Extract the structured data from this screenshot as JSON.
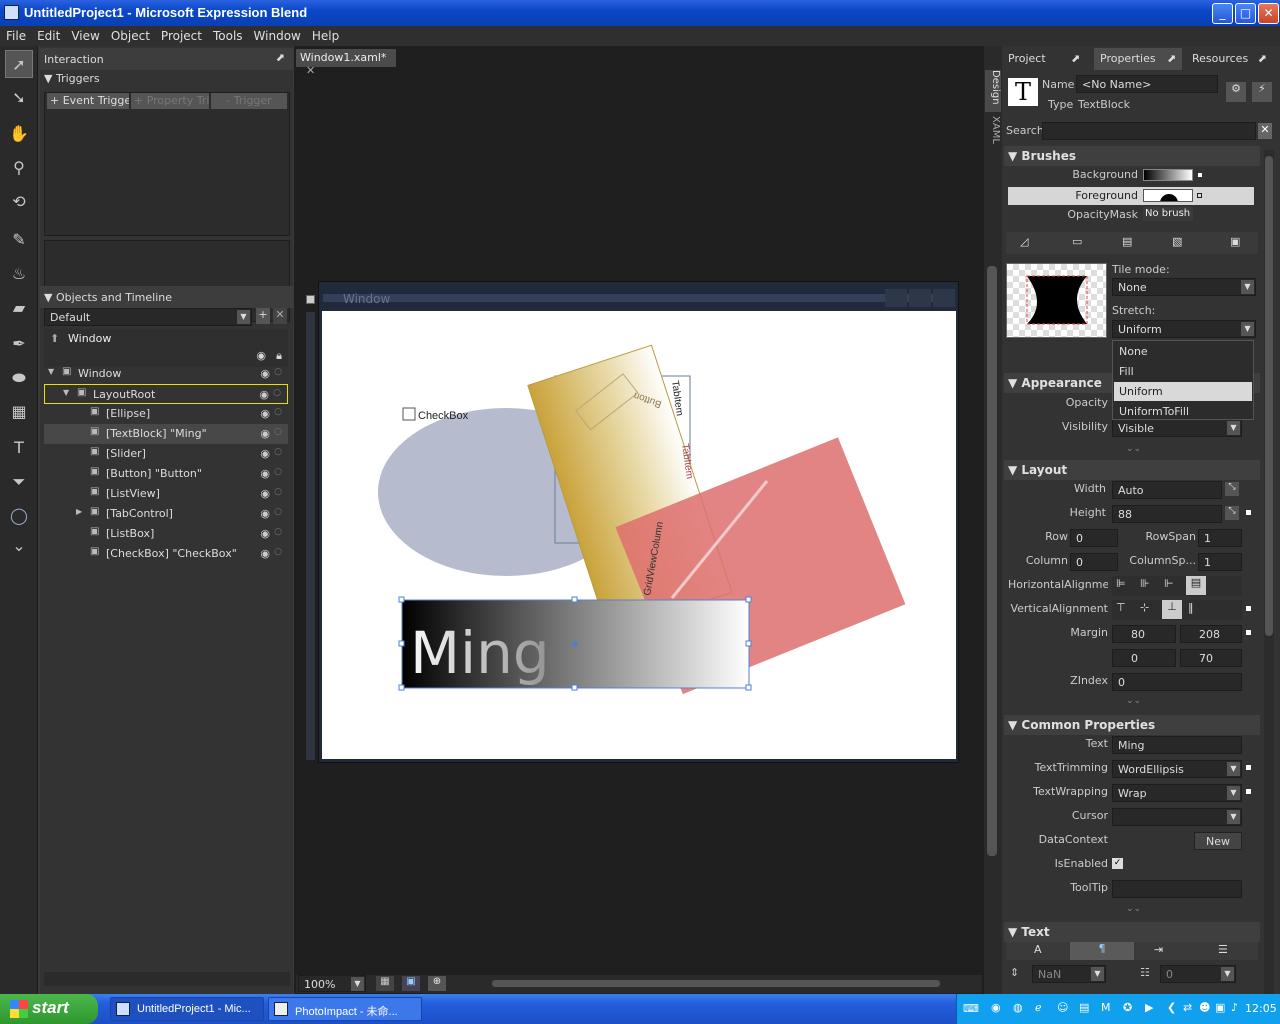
{
  "window": {
    "title": "UntitledProject1 - Microsoft Expression Blend",
    "min": "_",
    "max": "□",
    "close": "✕"
  },
  "menu": [
    "File",
    "Edit",
    "View",
    "Object",
    "Project",
    "Tools",
    "Window",
    "Help"
  ],
  "left": {
    "interaction_title": "Interaction",
    "triggers_title": "Triggers",
    "trigger_buttons": [
      "+ Event Trigger",
      "+ Property Trigg",
      "- Trigger"
    ],
    "objects_title": "Objects and Timeline",
    "timeline_default": "Default",
    "scope_label": "Window",
    "tree": [
      {
        "label": "Window",
        "indent": 0,
        "expander": "▼",
        "selected": false,
        "highlight": false
      },
      {
        "label": "LayoutRoot",
        "indent": 1,
        "expander": "▼",
        "selected": false,
        "highlight": true
      },
      {
        "label": "[Ellipse]",
        "indent": 2,
        "expander": "",
        "selected": false,
        "highlight": false
      },
      {
        "label": "[TextBlock] \"Ming\"",
        "indent": 2,
        "expander": "",
        "selected": true,
        "highlight": false
      },
      {
        "label": "[Slider]",
        "indent": 2,
        "expander": "",
        "selected": false,
        "highlight": false
      },
      {
        "label": "[Button] \"Button\"",
        "indent": 2,
        "expander": "",
        "selected": false,
        "highlight": false
      },
      {
        "label": "[ListView]",
        "indent": 2,
        "expander": "",
        "selected": false,
        "highlight": false
      },
      {
        "label": "[TabControl]",
        "indent": 2,
        "expander": "▶",
        "selected": false,
        "highlight": false
      },
      {
        "label": "[ListBox]",
        "indent": 2,
        "expander": "",
        "selected": false,
        "highlight": false
      },
      {
        "label": "[CheckBox] \"CheckBox\"",
        "indent": 2,
        "expander": "",
        "selected": false,
        "highlight": false
      }
    ]
  },
  "doc": {
    "tab_label": "Window1.xaml*",
    "tab_close": "✕",
    "artboard_title": "Window",
    "checkbox_label": "CheckBox",
    "button_label": "Button",
    "tabitem1": "TabItem",
    "tabitem2": "TabItem",
    "gridview": "GridViewColumn",
    "textblock_text": "Ming",
    "zoom": "100%",
    "side_tabs": [
      "Design",
      "XAML"
    ]
  },
  "right": {
    "tabs": [
      "Project",
      "Properties",
      "Resources"
    ],
    "name_label": "Name",
    "name_value": "<No Name>",
    "type_label": "Type",
    "type_value": "TextBlock",
    "search_label": "Search",
    "brushes": {
      "title": "Brushes",
      "items": [
        "Background",
        "Foreground",
        "OpacityMask"
      ],
      "opacitymask_value": "No brush",
      "tile_mode_label": "Tile mode:",
      "tile_mode_value": "None",
      "stretch_label": "Stretch:",
      "stretch_value": "Uniform",
      "stretch_options": [
        "None",
        "Fill",
        "Uniform",
        "UniformToFill"
      ],
      "stretch_selected": "Uniform"
    },
    "appearance": {
      "title": "Appearance",
      "opacity_label": "Opacity",
      "visibility_label": "Visibility",
      "visibility_value": "Visible"
    },
    "layout": {
      "title": "Layout",
      "width_label": "Width",
      "width_value": "Auto",
      "height_label": "Height",
      "height_value": "88",
      "row_label": "Row",
      "row_value": "0",
      "rowspan_label": "RowSpan",
      "rowspan_value": "1",
      "column_label": "Column",
      "column_value": "0",
      "columnspan_label": "ColumnSp...",
      "columnspan_value": "1",
      "halign_label": "HorizontalAlignme...",
      "valign_label": "VerticalAlignment",
      "margin_label": "Margin",
      "margin_left": "80",
      "margin_right": "208",
      "margin_top": "0",
      "margin_bottom": "70",
      "zindex_label": "ZIndex",
      "zindex_value": "0"
    },
    "common": {
      "title": "Common Properties",
      "text_label": "Text",
      "text_value": "Ming",
      "trimming_label": "TextTrimming",
      "trimming_value": "WordEllipsis",
      "wrapping_label": "TextWrapping",
      "wrapping_value": "Wrap",
      "cursor_label": "Cursor",
      "cursor_value": "",
      "datacontext_label": "DataContext",
      "new_button": "New",
      "isenabled_label": "IsEnabled",
      "isenabled_checked": true,
      "tooltip_label": "ToolTip",
      "tooltip_value": ""
    },
    "text": {
      "title": "Text",
      "font_size_value": "NaN",
      "line_value": "0"
    }
  },
  "taskbar": {
    "start": "start",
    "tasks": [
      "UntitledProject1 - Mic...",
      "PhotoImpact - 未命..."
    ],
    "clock": "12:05"
  },
  "colors": {
    "accent": "#e8e8e8",
    "highlight_border": "#e8e000",
    "selection": "#4a7fd8"
  }
}
